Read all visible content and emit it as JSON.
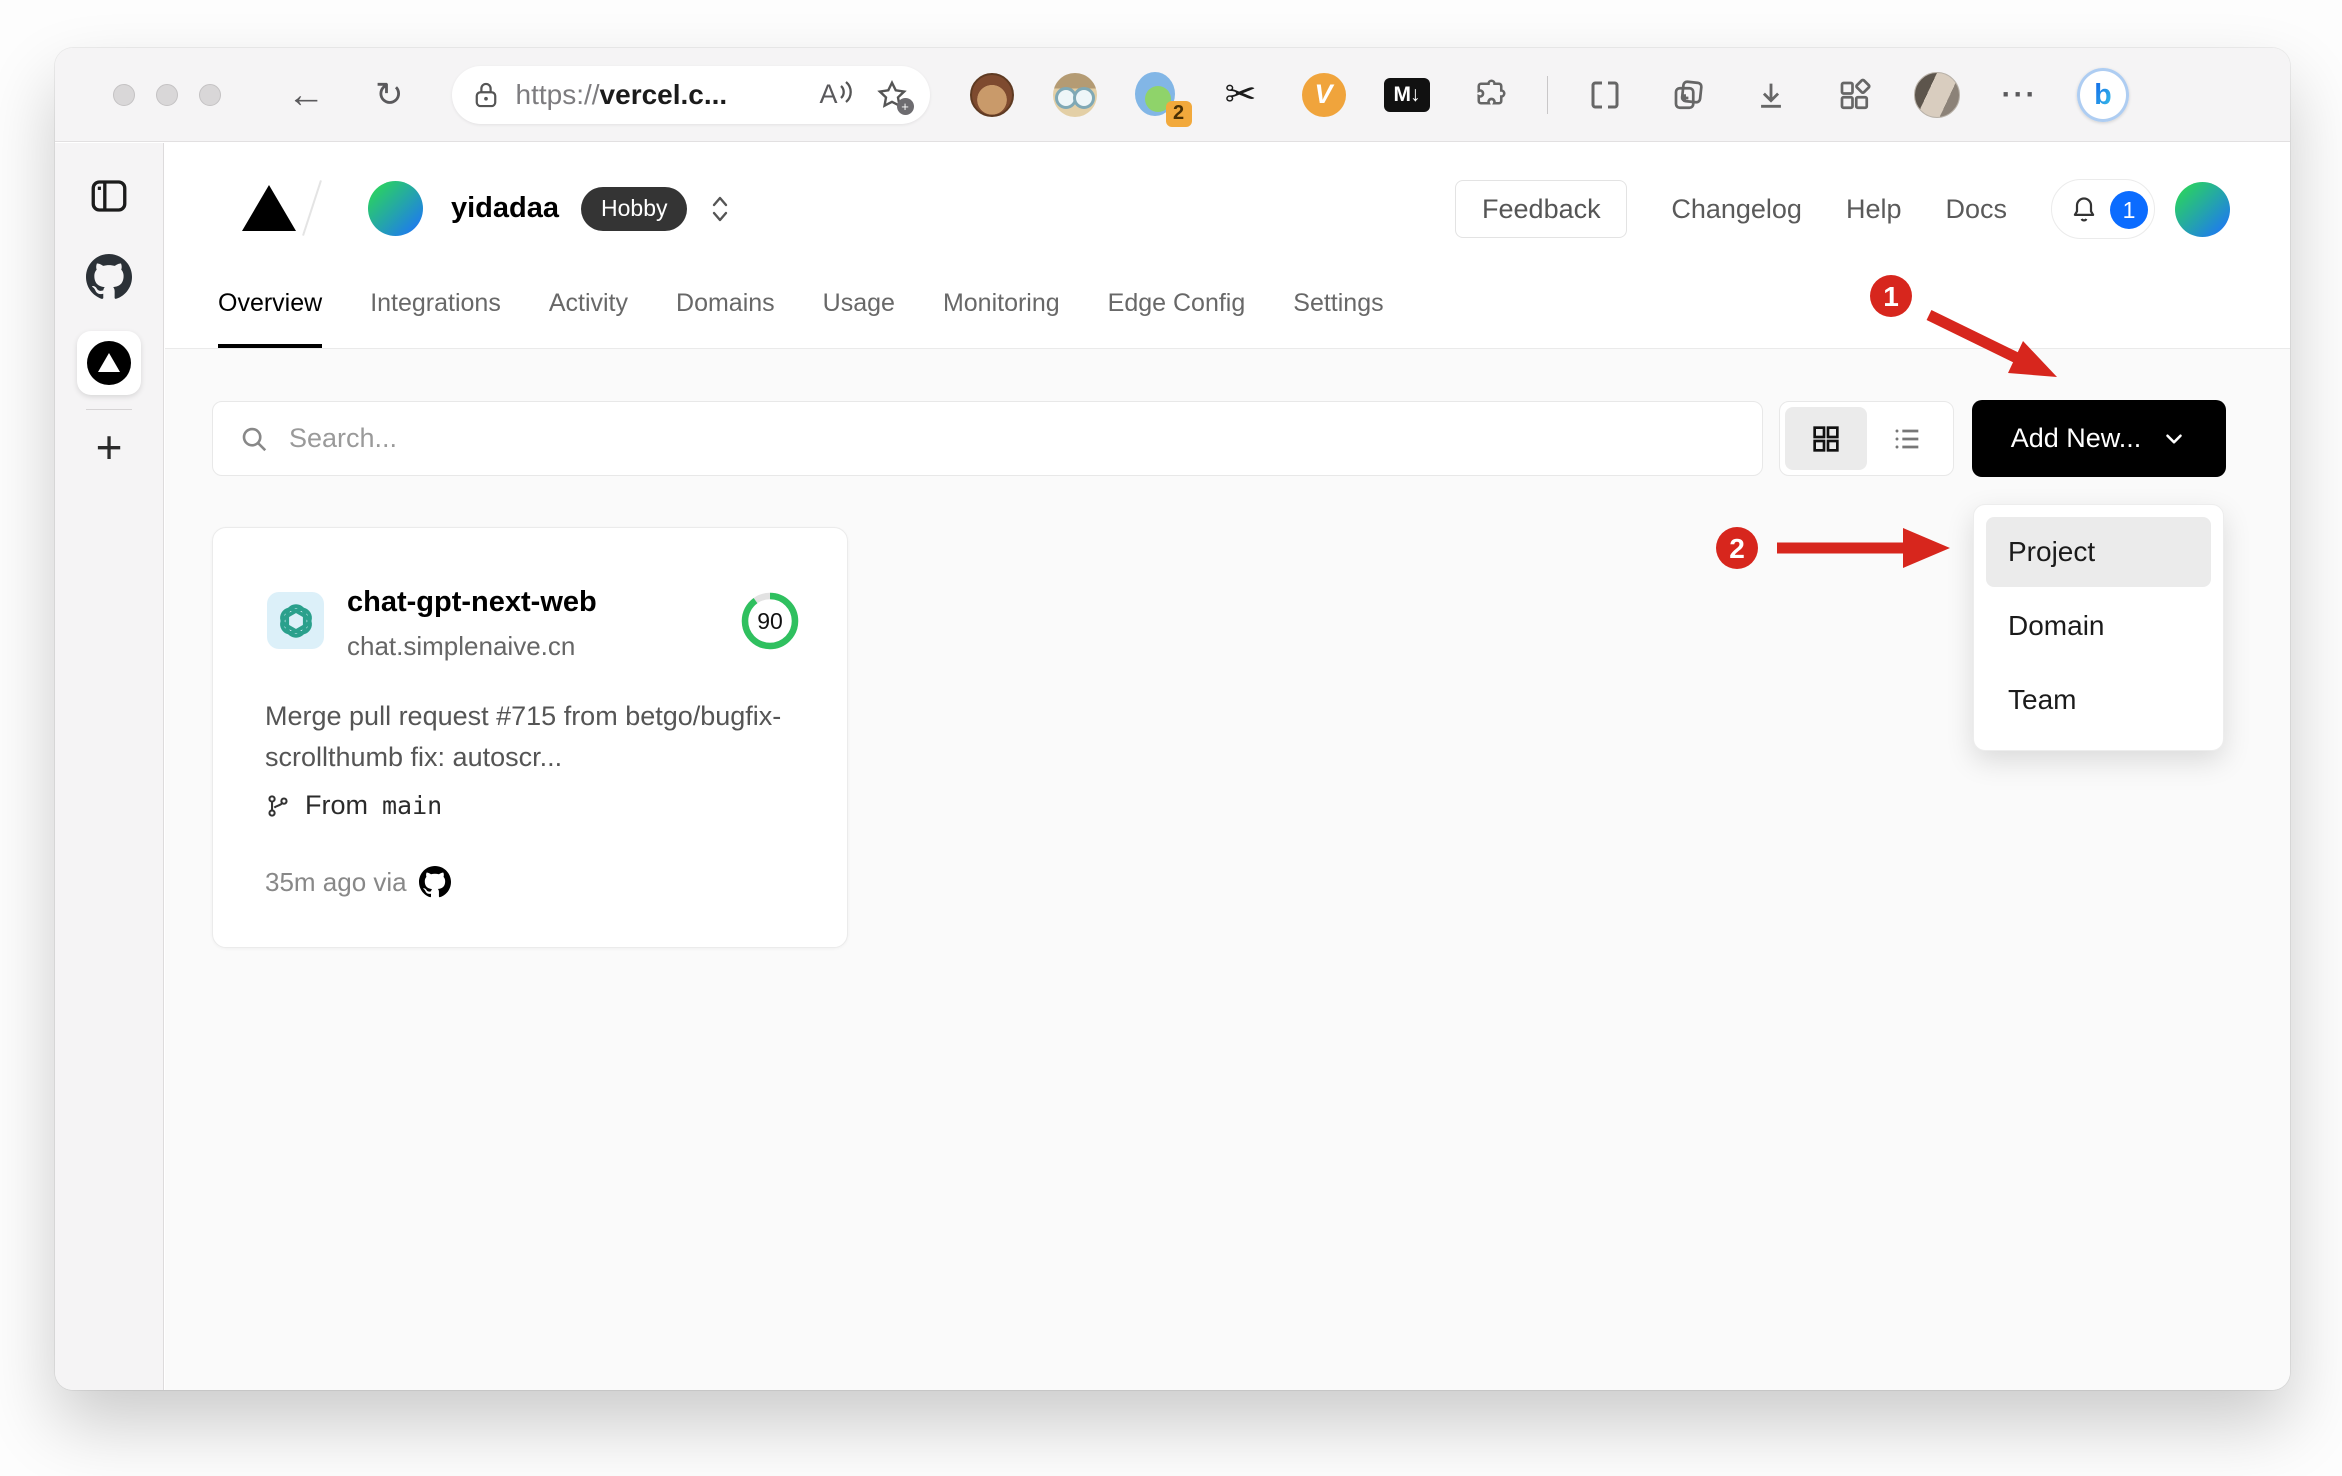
{
  "browser": {
    "url_scheme": "https://",
    "url_host": "vercel.c...",
    "read_aloud_label": "A",
    "ext_badge": "2",
    "ext_v_label": "V",
    "ext_md_label": "M↓",
    "bing_label": "b",
    "icons": {
      "back": "←",
      "refresh": "↻",
      "scissors": "✂",
      "more": "···",
      "new_tab": "+"
    }
  },
  "header": {
    "team": "yidadaa",
    "plan": "Hobby",
    "feedback": "Feedback",
    "links": [
      "Changelog",
      "Help",
      "Docs"
    ],
    "notifications": "1"
  },
  "nav": {
    "tabs": [
      "Overview",
      "Integrations",
      "Activity",
      "Domains",
      "Usage",
      "Monitoring",
      "Edge Config",
      "Settings"
    ]
  },
  "toolbar": {
    "search_placeholder": "Search...",
    "add_new": "Add New..."
  },
  "dropdown": {
    "items": [
      "Project",
      "Domain",
      "Team"
    ]
  },
  "card": {
    "name": "chat-gpt-next-web",
    "domain": "chat.simplenaive.cn",
    "score": "90",
    "commit": "Merge pull request #715 from betgo/bugfix-scrollthumb fix: autoscr...",
    "branch_label": "From",
    "branch": "main",
    "meta": "35m ago via"
  },
  "annotations": {
    "step1": "1",
    "step2": "2"
  },
  "colors": {
    "annotation_red": "#d7261d",
    "badge_blue": "#0b6cff",
    "score_green": "#2fc05f",
    "plan_badge_bg": "#343434",
    "add_new_bg": "#000000"
  }
}
